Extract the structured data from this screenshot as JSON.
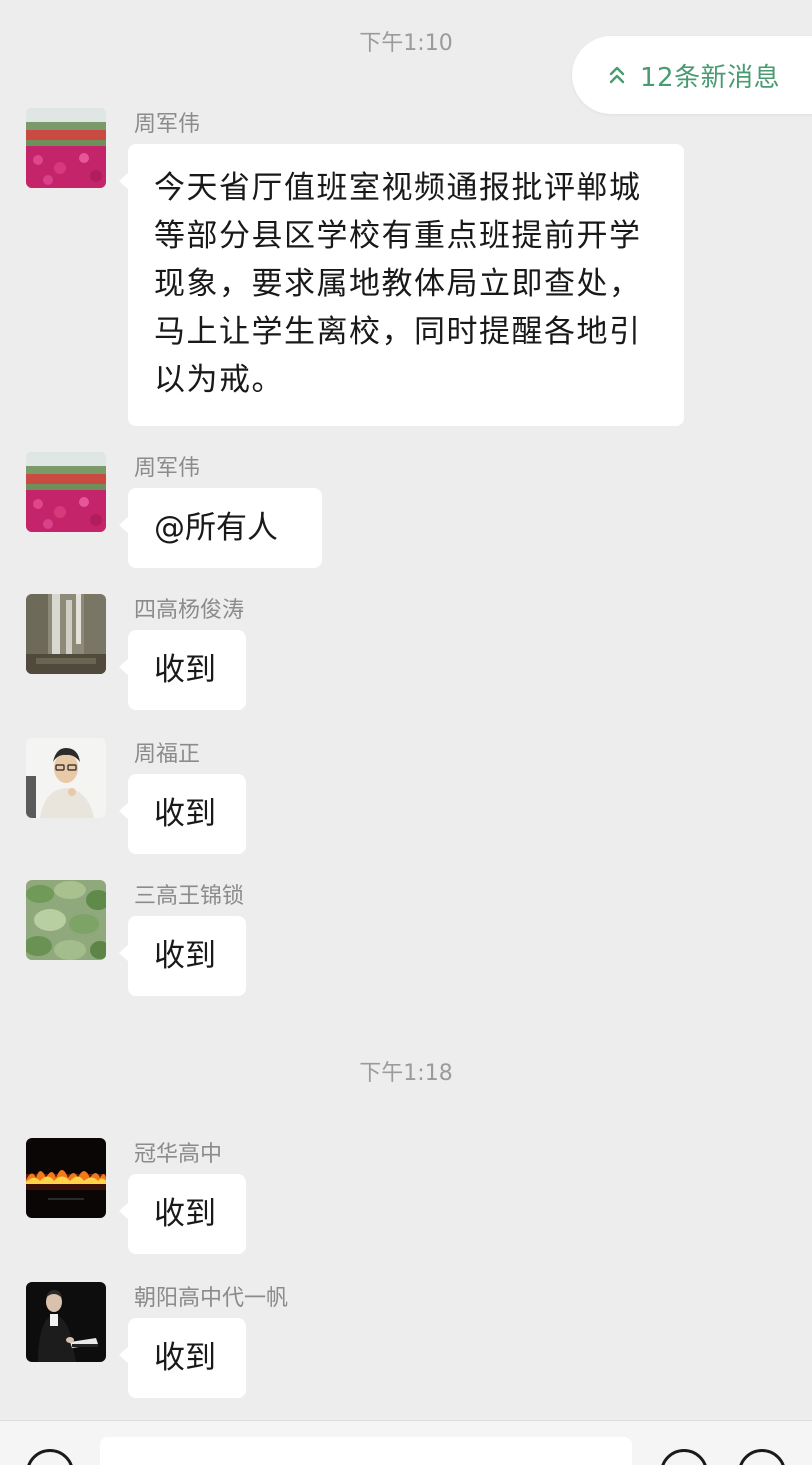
{
  "chat": {
    "time_separators": [
      "下午1:10",
      "下午1:18"
    ],
    "new_messages_label": "12条新消息",
    "accent_color": "#4a9b72",
    "messages": [
      {
        "sender": "周军伟",
        "text": "今天省厅值班室视频通报批评郸城等部分县区学校有重点班提前开学现象，要求属地教体局立即查处，马上让学生离校，同时提醒各地引以为戒。",
        "avatar": "flower-field-avatar"
      },
      {
        "sender": "周军伟",
        "text": "@所有人",
        "avatar": "flower-field-avatar"
      },
      {
        "sender": "四高杨俊涛",
        "text": "收到",
        "avatar": "waterfall-avatar"
      },
      {
        "sender": "周福正",
        "text": "收到",
        "avatar": "person-portrait-avatar"
      },
      {
        "sender": "三高王锦锁",
        "text": "收到",
        "avatar": "lotus-leaves-avatar"
      },
      {
        "sender": "冠华高中",
        "text": "收到",
        "avatar": "fire-avatar"
      },
      {
        "sender": "朝阳高中代一帆",
        "text": "收到",
        "avatar": "pianist-avatar"
      }
    ]
  },
  "input_bar": {
    "placeholder": ""
  }
}
